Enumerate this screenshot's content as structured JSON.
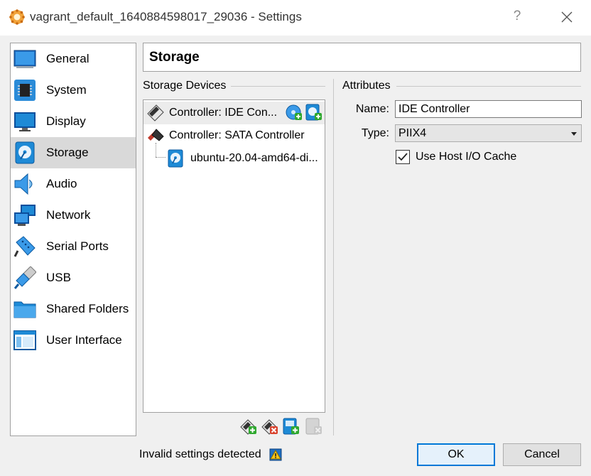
{
  "window": {
    "title": "vagrant_default_1640884598017_29036 - Settings",
    "help_glyph": "?"
  },
  "sidebar": {
    "items": [
      {
        "label": "General",
        "icon": "general-icon",
        "selected": false
      },
      {
        "label": "System",
        "icon": "system-chip-icon",
        "selected": false
      },
      {
        "label": "Display",
        "icon": "display-monitor-icon",
        "selected": false
      },
      {
        "label": "Storage",
        "icon": "storage-disk-icon",
        "selected": true
      },
      {
        "label": "Audio",
        "icon": "audio-speaker-icon",
        "selected": false
      },
      {
        "label": "Network",
        "icon": "network-icon",
        "selected": false
      },
      {
        "label": "Serial Ports",
        "icon": "serial-port-icon",
        "selected": false
      },
      {
        "label": "USB",
        "icon": "usb-icon",
        "selected": false
      },
      {
        "label": "Shared Folders",
        "icon": "folder-icon",
        "selected": false
      },
      {
        "label": "User Interface",
        "icon": "user-interface-icon",
        "selected": false
      }
    ]
  },
  "page": {
    "title": "Storage"
  },
  "storage_devices": {
    "group_title": "Storage Devices",
    "tree": [
      {
        "label": "Controller: IDE Con...",
        "icon": "ide-controller-icon",
        "selected": true
      },
      {
        "label": "Controller: SATA Controller",
        "icon": "sata-controller-icon",
        "selected": false
      },
      {
        "label": "ubuntu-20.04-amd64-di...",
        "icon": "hard-disk-icon",
        "selected": false
      }
    ],
    "toolbar": [
      "add-controller-icon",
      "remove-controller-icon",
      "add-attachment-icon",
      "remove-attachment-icon"
    ]
  },
  "attributes": {
    "group_title": "Attributes",
    "name_label": "Name:",
    "name_value": "IDE Controller",
    "type_label": "Type:",
    "type_value": "PIIX4",
    "host_cache_label": "Use Host I/O Cache",
    "host_cache_checked": true
  },
  "footer": {
    "status": "Invalid settings detected",
    "ok_label": "OK",
    "cancel_label": "Cancel"
  },
  "colors": {
    "accent": "#0078d7",
    "selected_bg": "#d9d9d9",
    "vbox_blue": "#1e8ad6"
  }
}
